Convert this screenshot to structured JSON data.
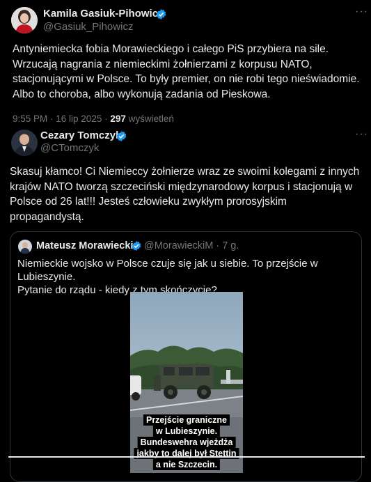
{
  "tweet": {
    "author_name": "Kamila Gasiuk-Pihowicz",
    "author_handle": "@Gasiuk_Pihowicz",
    "more_icon": "more-horizontal-icon",
    "lines": [
      "Antyniemiecka fobia Morawieckiego i całego PiS przybiera na sile.",
      "Wrzucają nagrania z niemieckimi  żołnierzami z korpusu NATO,",
      "stacjonującymi w Polsce. To były premier, on nie robi tego nieświadomie.",
      "Albo to choroba, albo wykonują zadania od Pieskowa."
    ],
    "time": "9:55 PM · 16 lip 2025 · ",
    "views_count": "297",
    "views_label": " wyświetleń"
  },
  "reply": {
    "author_name": "Cezary Tomczyk",
    "author_handle": "@CTomczyk",
    "lines": [
      "Skasuj kłamco! Ci Niemieccy żołnierze wraz ze swoimi kolegami z innych",
      "krajów NATO tworzą szczeciński międzynarodowy korpus i stacjonują w",
      "Polsce od 26 lat!!! Jesteś człowieku zwykłym prorosyjskim",
      "propagandystą."
    ]
  },
  "quote": {
    "author_name": "Mateusz Morawiecki",
    "author_handle": "@MorawieckiM",
    "time": "· 7 g.",
    "lines": [
      "Niemieckie wojsko w Polsce czuje się jak u siebie. To przejście w Lubieszynie.",
      "Pytanie do rządu - kiedy z tym skończycie?"
    ],
    "video_captions": [
      "Przejście graniczne",
      "w Lubieszynie.",
      "Bundeswehra wjeżdża",
      "jakby to dalej był Stettin",
      "a nie Szczecin."
    ]
  },
  "colors": {
    "background": "#000000",
    "text": "#e7e9ea",
    "secondary": "#71767b",
    "verified": "#1d9bf0"
  }
}
